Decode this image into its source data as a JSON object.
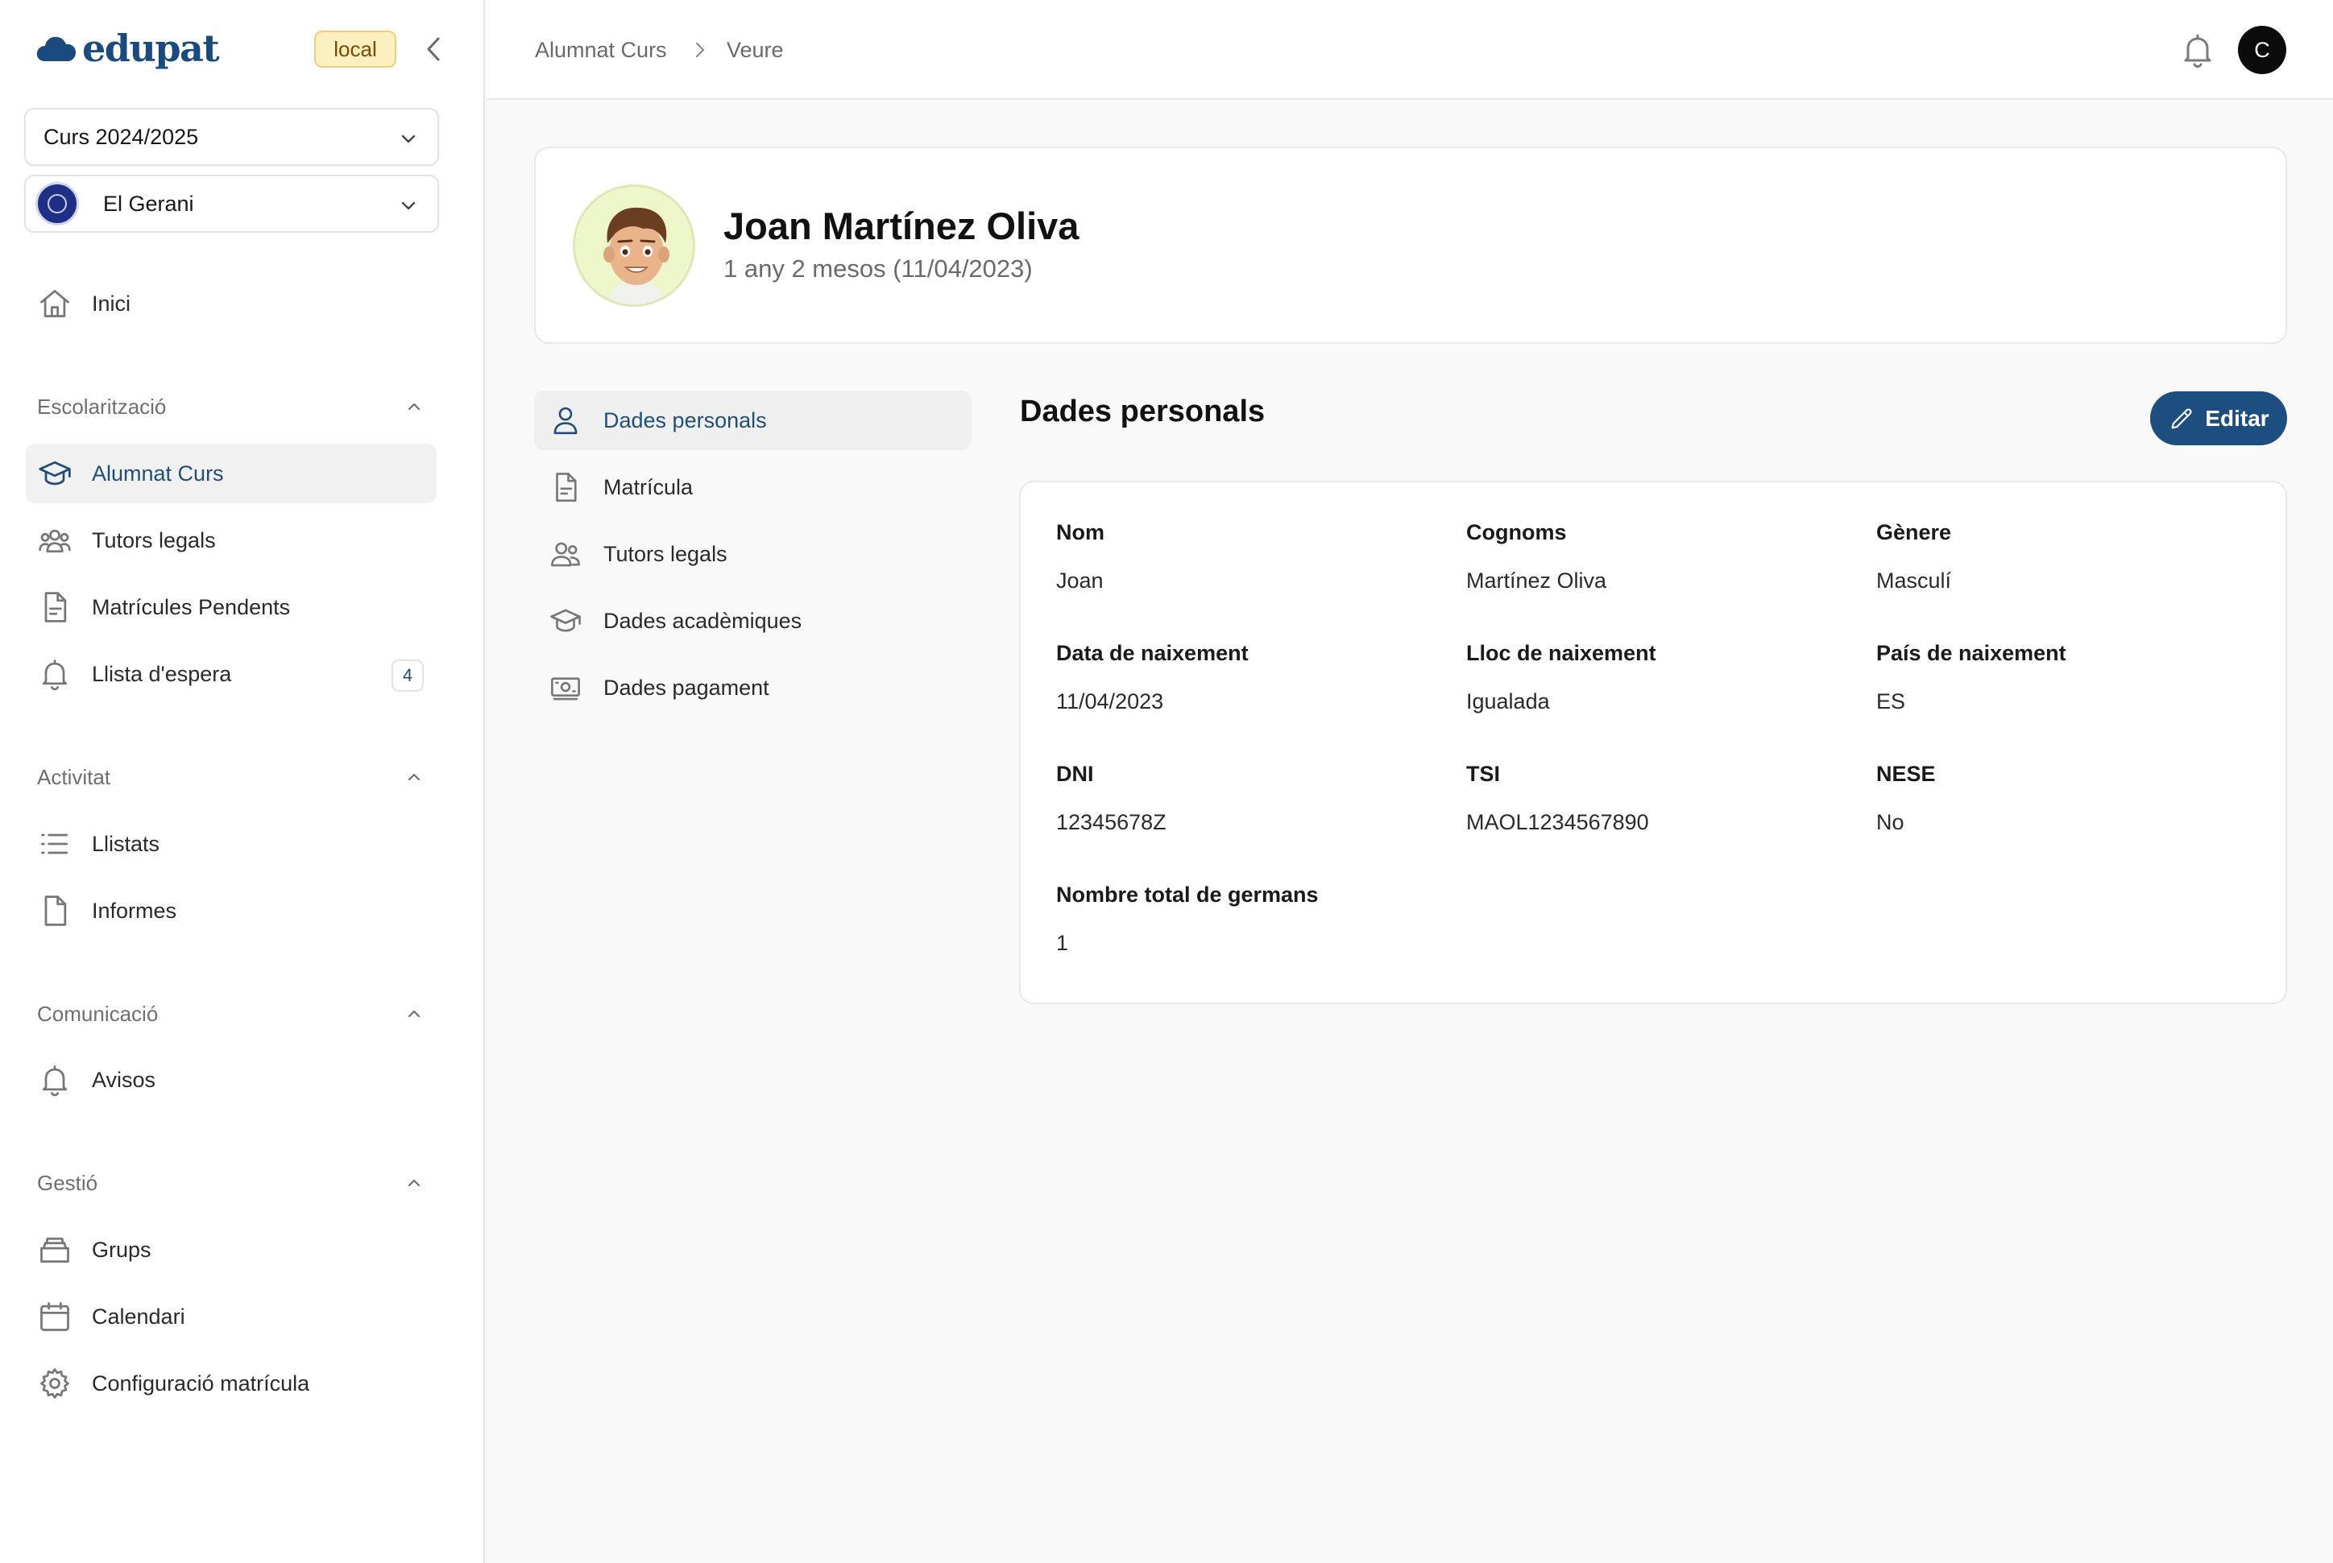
{
  "app": {
    "logo_text": "edupat",
    "environment": "local",
    "course_select": "Curs 2024/2025",
    "school_select": "El Gerani"
  },
  "sidebar": {
    "home": "Inici",
    "sections": [
      {
        "title": "Escolarització",
        "items": [
          {
            "label": "Alumnat Curs",
            "icon": "graduation-cap-icon",
            "active": true
          },
          {
            "label": "Tutors legals",
            "icon": "users-icon"
          },
          {
            "label": "Matrícules Pendents",
            "icon": "document-icon"
          },
          {
            "label": "Llista d'espera",
            "icon": "bell-icon",
            "badge": "4"
          }
        ]
      },
      {
        "title": "Activitat",
        "items": [
          {
            "label": "Llistats",
            "icon": "list-icon"
          },
          {
            "label": "Informes",
            "icon": "file-icon"
          }
        ]
      },
      {
        "title": "Comunicació",
        "items": [
          {
            "label": "Avisos",
            "icon": "bell-icon"
          }
        ]
      },
      {
        "title": "Gestió",
        "items": [
          {
            "label": "Grups",
            "icon": "archive-icon"
          },
          {
            "label": "Calendari",
            "icon": "calendar-icon"
          },
          {
            "label": "Configuració matrícula",
            "icon": "gear-icon"
          }
        ]
      }
    ]
  },
  "topbar": {
    "breadcrumb": [
      "Alumnat Curs",
      "Veure"
    ],
    "user_initial": "C"
  },
  "student": {
    "name": "Joan Martínez Oliva",
    "age": "1 any 2 mesos (11/04/2023)"
  },
  "subnav": [
    {
      "label": "Dades personals",
      "icon": "user-icon",
      "active": true
    },
    {
      "label": "Matrícula",
      "icon": "document-icon"
    },
    {
      "label": "Tutors legals",
      "icon": "users-icon"
    },
    {
      "label": "Dades acadèmiques",
      "icon": "graduation-cap-icon"
    },
    {
      "label": "Dades pagament",
      "icon": "banknote-icon"
    }
  ],
  "personal_data": {
    "title": "Dades personals",
    "edit_label": "Editar",
    "fields": [
      {
        "label": "Nom",
        "value": "Joan"
      },
      {
        "label": "Cognoms",
        "value": "Martínez Oliva"
      },
      {
        "label": "Gènere",
        "value": "Masculí"
      },
      {
        "label": "Data de naixement",
        "value": "11/04/2023"
      },
      {
        "label": "Lloc de naixement",
        "value": "Igualada"
      },
      {
        "label": "País de naixement",
        "value": "ES"
      },
      {
        "label": "DNI",
        "value": "12345678Z"
      },
      {
        "label": "TSI",
        "value": "MAOL1234567890"
      },
      {
        "label": "NESE",
        "value": "No"
      },
      {
        "label": "Nombre total de germans",
        "value": "1"
      }
    ]
  },
  "colors": {
    "accent": "#1d4e80",
    "active_bg": "#f1f1f1",
    "env_badge_bg": "#fdf0c0"
  }
}
